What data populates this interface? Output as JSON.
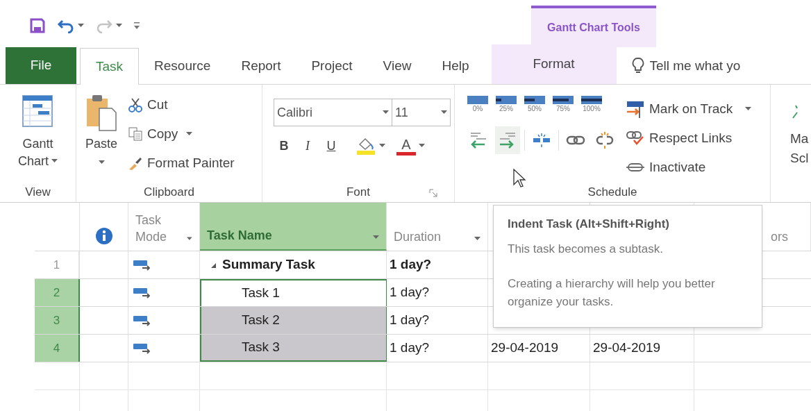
{
  "quick_access": {
    "undo_enabled": true,
    "redo_enabled": false
  },
  "contextual_group": {
    "title": "Gantt Chart Tools"
  },
  "tabs": [
    {
      "label": "File",
      "kind": "file",
      "selected": false
    },
    {
      "label": "Task",
      "kind": "tab",
      "selected": true
    },
    {
      "label": "Resource",
      "kind": "tab",
      "selected": false
    },
    {
      "label": "Report",
      "kind": "tab",
      "selected": false
    },
    {
      "label": "Project",
      "kind": "tab",
      "selected": false
    },
    {
      "label": "View",
      "kind": "tab",
      "selected": false
    },
    {
      "label": "Help",
      "kind": "tab",
      "selected": false
    },
    {
      "label": "Format",
      "kind": "contextual",
      "selected": false
    }
  ],
  "tell_me": {
    "placeholder": "Tell me what yo"
  },
  "ribbon": {
    "view": {
      "label": "View",
      "button_lines": [
        "Gantt",
        "Chart"
      ]
    },
    "clipboard": {
      "label": "Clipboard",
      "paste": "Paste",
      "items": [
        {
          "label": "Cut",
          "kind": "cut",
          "dropdown": false
        },
        {
          "label": "Copy",
          "kind": "copy",
          "dropdown": true
        },
        {
          "label": "Format Painter",
          "kind": "painter",
          "dropdown": false
        }
      ]
    },
    "font": {
      "label": "Font",
      "font_name": "Calibri",
      "font_size": "11",
      "styles": [
        {
          "label": "B",
          "kind": "bold"
        },
        {
          "label": "I",
          "kind": "italic"
        },
        {
          "label": "U",
          "kind": "underline"
        }
      ],
      "font_color_label": "A"
    },
    "schedule": {
      "label": "Schedule",
      "percent_buttons": [
        {
          "label": "0%"
        },
        {
          "label": "25%"
        },
        {
          "label": "50%"
        },
        {
          "label": "75%"
        },
        {
          "label": "100%"
        }
      ],
      "tools": [
        {
          "kind": "outdent",
          "hovered": false
        },
        {
          "kind": "indent",
          "hovered": true
        },
        {
          "kind": "split",
          "hovered": false
        },
        {
          "kind": "link",
          "hovered": false
        },
        {
          "kind": "unlink",
          "hovered": false
        }
      ],
      "actions": [
        {
          "label": "Mark on Track",
          "kind": "mark",
          "dropdown": true
        },
        {
          "label": "Respect Links",
          "kind": "respect",
          "dropdown": false
        },
        {
          "label": "Inactivate",
          "kind": "inactivate",
          "dropdown": false
        }
      ]
    },
    "cut_button": {
      "lines": [
        "Ma",
        "Scl"
      ]
    }
  },
  "table": {
    "columns": [
      {
        "kind": "row_number"
      },
      {
        "kind": "indicators"
      },
      {
        "kind": "text",
        "label": "Task Mode",
        "dropdown": true,
        "selected": false
      },
      {
        "kind": "text",
        "label": "Task Name",
        "dropdown": true,
        "selected": true
      },
      {
        "kind": "text",
        "label": "Duration",
        "dropdown": true,
        "selected": false
      },
      {
        "kind": "blank"
      },
      {
        "kind": "blank"
      },
      {
        "kind": "text",
        "label": "ors",
        "dropdown": false,
        "selected": false
      }
    ],
    "rows": [
      {
        "id": "1",
        "name": "Summary Task",
        "duration": "1 day?",
        "summary": true,
        "expanded": true,
        "selected": false,
        "children": [
          {
            "id": "2",
            "name": "Task 1",
            "duration": "1 day?",
            "summary": false,
            "selected": true,
            "active": true
          },
          {
            "id": "3",
            "name": "Task 2",
            "duration": "1 day?",
            "summary": false,
            "selected": true,
            "active": false
          },
          {
            "id": "4",
            "name": "Task 3",
            "duration": "1 day?",
            "start": "29-04-2019",
            "finish": "29-04-2019",
            "summary": false,
            "selected": true,
            "active": false
          }
        ]
      }
    ]
  },
  "tooltip": {
    "title": "Indent Task (Alt+Shift+Right)",
    "paragraphs": [
      "This task becomes a subtask.",
      "Creating a hierarchy will help you better organize your tasks."
    ]
  }
}
